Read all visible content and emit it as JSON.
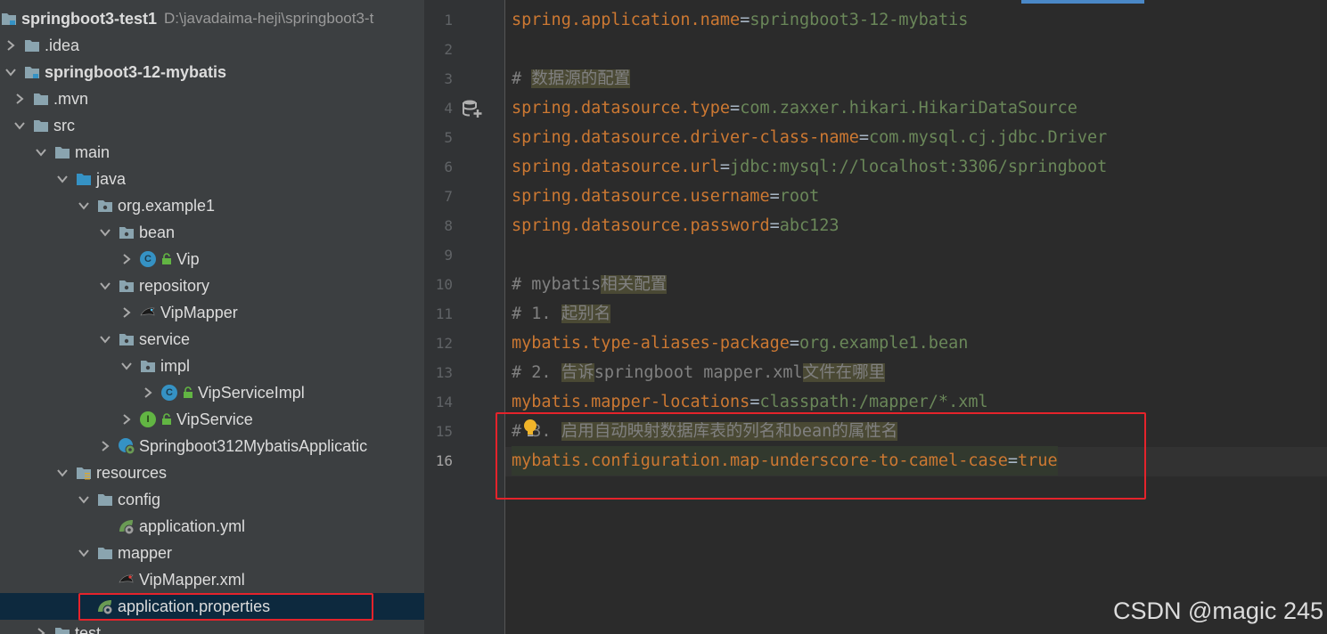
{
  "tree": {
    "root": {
      "name": "springboot3-test1",
      "path": "D:\\javadaima-heji\\springboot3-t"
    },
    "items": [
      {
        "label": ".idea"
      },
      {
        "label": "springboot3-12-mybatis"
      },
      {
        "label": ".mvn"
      },
      {
        "label": "src"
      },
      {
        "label": "main"
      },
      {
        "label": "java"
      },
      {
        "label": "org.example1"
      },
      {
        "label": "bean"
      },
      {
        "label": "Vip",
        "badge": "C"
      },
      {
        "label": "repository"
      },
      {
        "label": "VipMapper"
      },
      {
        "label": "service"
      },
      {
        "label": "impl"
      },
      {
        "label": "VipServiceImpl",
        "badge": "C"
      },
      {
        "label": "VipService",
        "badge": "I"
      },
      {
        "label": "Springboot312MybatisApplicatic"
      },
      {
        "label": "resources"
      },
      {
        "label": "config"
      },
      {
        "label": "application.yml"
      },
      {
        "label": "mapper"
      },
      {
        "label": "VipMapper.xml"
      },
      {
        "label": "application.properties"
      },
      {
        "label": "test"
      }
    ]
  },
  "editor": {
    "lines": [
      {
        "n": "1",
        "key": "spring.application.name",
        "eq": "=",
        "val": "springboot3-12-mybatis"
      },
      {
        "n": "2"
      },
      {
        "n": "3",
        "cm_hash": "# ",
        "cm_hl": "数据源的配置"
      },
      {
        "n": "4",
        "key": "spring.datasource.type",
        "eq": "=",
        "val": "com.zaxxer.hikari.HikariDataSource"
      },
      {
        "n": "5",
        "key": "spring.datasource.driver-class-name",
        "eq": "=",
        "val": "com.mysql.cj.jdbc.Driver"
      },
      {
        "n": "6",
        "key": "spring.datasource.url",
        "eq": "=",
        "val": "jdbc:mysql://localhost:3306/springboot"
      },
      {
        "n": "7",
        "key": "spring.datasource.username",
        "eq": "=",
        "val": "root"
      },
      {
        "n": "8",
        "key": "spring.datasource.password",
        "eq": "=",
        "val": "abc123"
      },
      {
        "n": "9"
      },
      {
        "n": "10",
        "cm_hash": "# mybatis",
        "cm_hl": "相关配置"
      },
      {
        "n": "11",
        "cm_hash": "# 1. ",
        "cm_hl": "起别名"
      },
      {
        "n": "12",
        "key": "mybatis.type-aliases-package",
        "eq": "=",
        "val": "org.example1.bean"
      },
      {
        "n": "13",
        "cm_hash": "# 2. ",
        "cm_hl": "告诉",
        "cm_mid": "springboot mapper.xml",
        "cm_hl2": "文件在哪里"
      },
      {
        "n": "14",
        "key": "mybatis.mapper-locations",
        "eq": "=",
        "val": "classpath:/mapper/*.xml"
      },
      {
        "n": "15",
        "cm_hash": "# 3. ",
        "cm_hl": "启用自动映射数据库表的列名和",
        "cm_mid": "bean",
        "cm_hl2": "的属性名"
      },
      {
        "n": "16",
        "key": "mybatis.configuration.map-underscore-to-camel-case",
        "eq": "=",
        "val": "true"
      }
    ]
  },
  "watermark": "CSDN @magic 245",
  "colors": {
    "key": "#cc7832",
    "value": "#6a8759",
    "comment": "#808080",
    "highlight_box": "#e5232b",
    "selection": "#0d293e"
  }
}
